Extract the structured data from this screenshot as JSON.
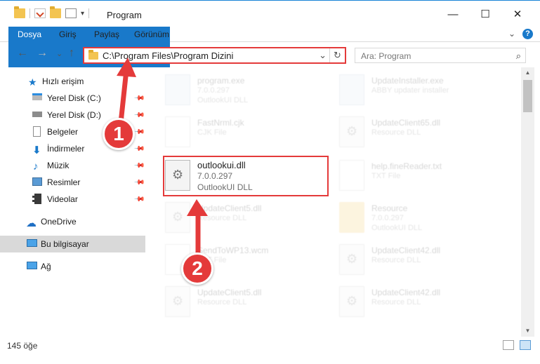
{
  "window": {
    "title": "Program",
    "minimize_glyph": "—",
    "maximize_glyph": "☐",
    "close_glyph": "✕"
  },
  "ribbon": {
    "tabs": [
      "Dosya",
      "Giriş",
      "Paylaş",
      "Görünüm"
    ],
    "expand_glyph": "⌄",
    "help_glyph": "?"
  },
  "nav": {
    "back_glyph": "←",
    "forward_glyph": "→",
    "recent_glyph": "⌄",
    "up_glyph": "↑"
  },
  "address": {
    "path": "C:\\Program Files\\Program Dizini",
    "dropdown_glyph": "⌄",
    "refresh_glyph": "↻"
  },
  "search": {
    "placeholder": "Ara: Program",
    "icon_glyph": "⌕"
  },
  "sidebar": {
    "items": [
      {
        "label": "Hızlı erişim"
      },
      {
        "label": "Yerel Disk (C:)"
      },
      {
        "label": "Yerel Disk (D:)"
      },
      {
        "label": "Belgeler"
      },
      {
        "label": "İndirmeler"
      },
      {
        "label": "Müzik"
      },
      {
        "label": "Resimler"
      },
      {
        "label": "Videolar"
      },
      {
        "label": "OneDrive"
      },
      {
        "label": "Bu bilgisayar"
      },
      {
        "label": "Ağ"
      }
    ]
  },
  "files": [
    {
      "name": "program.exe",
      "version": "7.0.0.297",
      "desc": "OutlookUI DLL"
    },
    {
      "name": "UpdateInstaller.exe",
      "version": "ABBY updater installer",
      "desc": ""
    },
    {
      "name": "FastNrml.cjk",
      "version": "CJK File",
      "desc": ""
    },
    {
      "name": "UpdateClient65.dll",
      "version": "Resource DLL",
      "desc": ""
    },
    {
      "name": "outlookui.dll",
      "version": "7.0.0.297",
      "desc": "OutlookUI DLL"
    },
    {
      "name": "help.fineReader.txt",
      "version": "TXT File",
      "desc": ""
    },
    {
      "name": "UpdateClient5.dll",
      "version": "Resource DLL",
      "desc": ""
    },
    {
      "name": "Resource",
      "version": "7.0.0.297",
      "desc": "OutlookUI DLL"
    },
    {
      "name": "SendToWP13.wcm",
      "version": "TXT File",
      "desc": ""
    },
    {
      "name": "UpdateClient42.dll",
      "version": "Resource DLL",
      "desc": ""
    },
    {
      "name": "UpdateClient5.dll",
      "version": "Resource DLL",
      "desc": ""
    },
    {
      "name": "UpdateClient42.dll",
      "version": "Resource DLL",
      "desc": ""
    }
  ],
  "scrollbar": {
    "up_glyph": "▲",
    "down_glyph": "▼"
  },
  "status": {
    "count": "145 öğe"
  },
  "annotations": {
    "step1": "1",
    "step2": "2",
    "color": "#e43a3a"
  }
}
